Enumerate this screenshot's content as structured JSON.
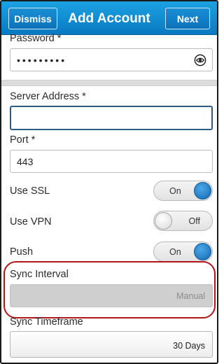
{
  "header": {
    "title": "Add Account",
    "dismiss_label": "Dismiss",
    "next_label": "Next"
  },
  "fields": {
    "password_label": "Password *",
    "password_value": "•••••••••",
    "server_label": "Server Address *",
    "server_value": "",
    "port_label": "Port *",
    "port_value": "443"
  },
  "toggles": {
    "ssl_label": "Use SSL",
    "ssl_state": "On",
    "vpn_label": "Use VPN",
    "vpn_state": "Off",
    "push_label": "Push",
    "push_state": "On"
  },
  "sync": {
    "interval_label": "Sync Interval",
    "interval_value": "Manual",
    "timeframe_label": "Sync Timeframe",
    "timeframe_value": "30 Days"
  },
  "colors": {
    "titlebar": "#0a79c2",
    "toggle_on": "#1668b1",
    "highlight": "#b0151b"
  },
  "icons": {
    "eye": "eye-icon"
  }
}
